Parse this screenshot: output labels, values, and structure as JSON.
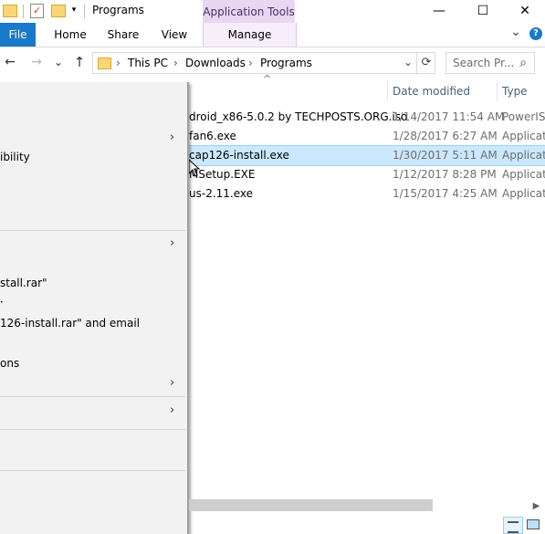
{
  "window": {
    "title": "Programs",
    "contextual_tab_group": "Application Tools",
    "minimize_glyph": "—",
    "maximize_glyph": "☐",
    "close_glyph": "✕"
  },
  "ribbon": {
    "tabs": [
      "File",
      "Home",
      "Share",
      "View",
      "Manage"
    ],
    "expand_glyph": "⌄",
    "help_glyph": "?"
  },
  "navigation": {
    "back_glyph": "←",
    "forward_glyph": "→",
    "recent_glyph": "⌄",
    "up_glyph": "↑",
    "breadcrumb": [
      "This PC",
      "Downloads",
      "Programs"
    ],
    "breadcrumb_sep": "›",
    "dropdown_glyph": "⌄",
    "refresh_glyph": "⟳",
    "search_placeholder": "Search Pr...",
    "search_glyph": "⌕"
  },
  "file_list": {
    "sort_glyph": "^",
    "columns": [
      "Date modified",
      "Type"
    ],
    "rows": [
      {
        "name": "droid_x86-5.0.2 by TECHPOSTS.ORG.iso",
        "date": "1/14/2017 11:54 AM",
        "type": "PowerISO"
      },
      {
        "name": "fan6.exe",
        "date": "1/28/2017 6:27 AM",
        "type": "Applicatio"
      },
      {
        "name": "cap126-install.exe",
        "date": "1/30/2017 5:11 AM",
        "type": "Applicatio"
      },
      {
        "name": "MSetup.EXE",
        "date": "1/12/2017 8:28 PM",
        "type": "Applicatio"
      },
      {
        "name": "us-2.11.exe",
        "date": "1/15/2017 4:25 AM",
        "type": "Applicatio"
      }
    ]
  },
  "context_menu": {
    "items": [
      {
        "label": "ibility"
      },
      {
        "label": "stall.rar\""
      },
      {
        "label": "•"
      },
      {
        "label": "126-install.rar\" and email"
      },
      {
        "label": "ons"
      }
    ],
    "submenu_glyph": "›"
  },
  "statusbar": {
    "scroll_right_glyph": "▶"
  }
}
